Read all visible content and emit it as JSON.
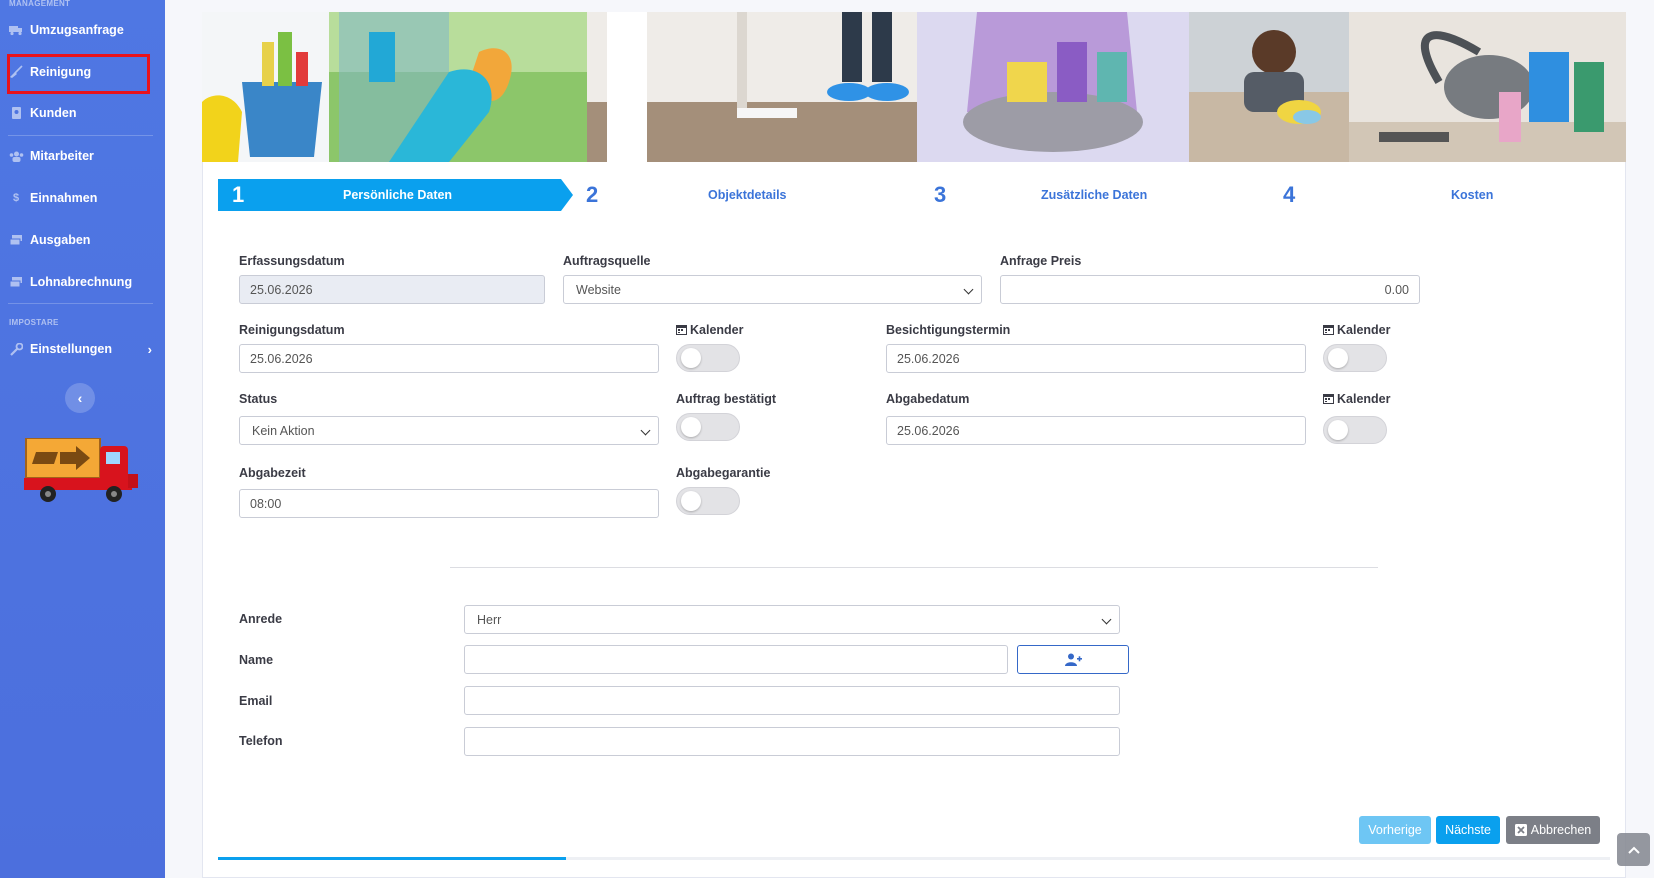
{
  "sidebar": {
    "heading_management": "MANAGEMENT",
    "heading_impostare": "IMPOSTARE",
    "items": [
      {
        "label": "Umzugsanfrage",
        "icon": "truck-icon"
      },
      {
        "label": "Reinigung",
        "icon": "broom-icon"
      },
      {
        "label": "Kunden",
        "icon": "address-book-icon"
      },
      {
        "label": "Mitarbeiter",
        "icon": "users-icon"
      },
      {
        "label": "Einnahmen",
        "icon": "dollar-icon"
      },
      {
        "label": "Ausgaben",
        "icon": "money-icon"
      },
      {
        "label": "Lohnabrechnung",
        "icon": "money-icon"
      },
      {
        "label": "Einstellungen",
        "icon": "wrench-icon"
      }
    ],
    "active_item": "Reinigung"
  },
  "wizard": {
    "steps": [
      {
        "num": "1",
        "title": "Persönliche Daten",
        "active": true
      },
      {
        "num": "2",
        "title": "Objektdetails"
      },
      {
        "num": "3",
        "title": "Zusätzliche Daten"
      },
      {
        "num": "4",
        "title": "Kosten"
      }
    ],
    "progress_fraction": 0.25
  },
  "form": {
    "erfassungsdatum": {
      "label": "Erfassungsdatum",
      "value": "25.06.2026"
    },
    "auftragsquelle": {
      "label": "Auftragsquelle",
      "value": "Website"
    },
    "anfrage_preis": {
      "label": "Anfrage Preis",
      "value": "0.00"
    },
    "reinigungsdatum": {
      "label": "Reinigungsdatum",
      "value": "25.06.2026"
    },
    "kalender1": {
      "label": "Kalender",
      "checked": false
    },
    "besichtigungstermin": {
      "label": "Besichtigungstermin",
      "value": "25.06.2026"
    },
    "kalender2": {
      "label": "Kalender",
      "checked": false
    },
    "status": {
      "label": "Status",
      "value": "Kein Aktion"
    },
    "auftrag_bestaetigt": {
      "label": "Auftrag bestätigt",
      "checked": false
    },
    "abgabedatum": {
      "label": "Abgabedatum",
      "value": "25.06.2026"
    },
    "kalender3": {
      "label": "Kalender",
      "checked": false
    },
    "abgabezeit": {
      "label": "Abgabezeit",
      "value": "08:00"
    },
    "abgabegarantie": {
      "label": "Abgabegarantie",
      "checked": false
    },
    "anrede": {
      "label": "Anrede",
      "value": "Herr"
    },
    "name": {
      "label": "Name",
      "value": ""
    },
    "email": {
      "label": "Email",
      "value": ""
    },
    "telefon": {
      "label": "Telefon",
      "value": ""
    }
  },
  "buttons": {
    "prev": "Vorherige",
    "next": "Nächste",
    "cancel": "Abbrechen"
  },
  "colors": {
    "sidebar": "#4e73df",
    "accent": "#0aa0ee",
    "highlight": "#e8121b"
  }
}
